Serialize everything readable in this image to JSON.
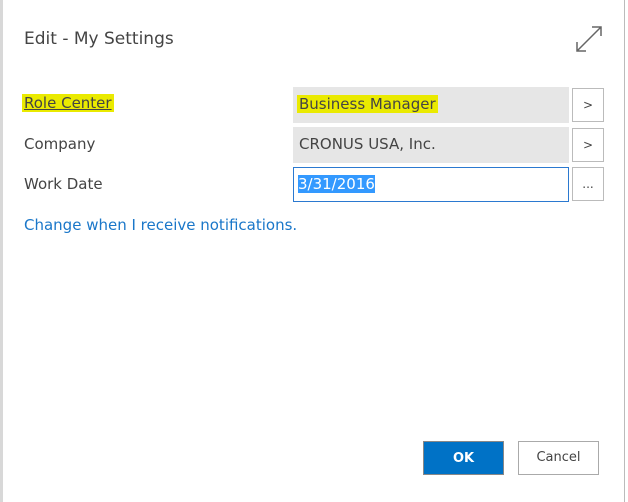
{
  "dialog": {
    "title": "Edit - My Settings"
  },
  "fields": [
    {
      "label": "Role Center",
      "value": "Business Manager",
      "button": ">"
    },
    {
      "label": "Company",
      "value": "CRONUS USA, Inc.",
      "button": ">"
    },
    {
      "label": "Work Date",
      "value": "3/31/2016",
      "button": "..."
    }
  ],
  "link": "Change when I receive notifications.",
  "actions": {
    "ok": "OK",
    "cancel": "Cancel"
  },
  "colors": {
    "accent": "#0072c6",
    "link": "#1a77c9",
    "highlight": "#eaea00"
  }
}
